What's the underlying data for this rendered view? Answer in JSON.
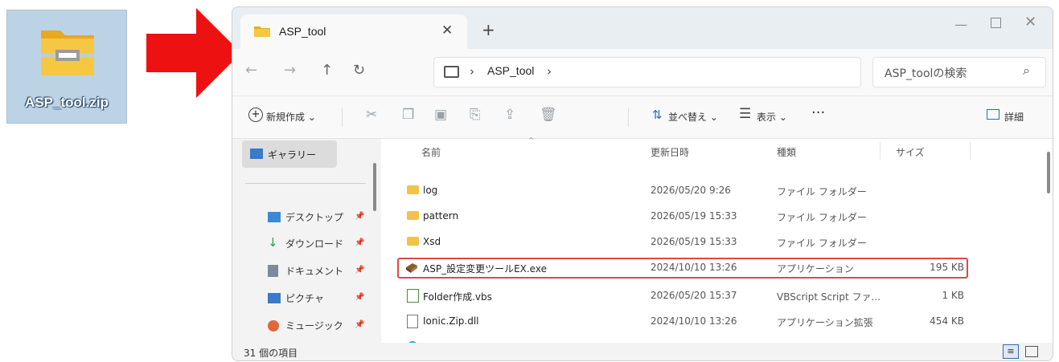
{
  "desktop": {
    "zip_label": "ASP_tool.zip"
  },
  "window": {
    "tab_title": "ASP_tool",
    "breadcrumb": "ASP_tool",
    "search_placeholder": "ASP_toolの検索"
  },
  "toolbar": {
    "new_label": "新規作成 ⌄",
    "sort_label": "並べ替え ⌄",
    "view_label": "表示 ⌄",
    "details_label": "詳細"
  },
  "sidebar": {
    "gallery": "ギャラリー",
    "items": [
      {
        "label": "デスクトップ",
        "icon": "desktop-icon"
      },
      {
        "label": "ダウンロード",
        "icon": "download-icon"
      },
      {
        "label": "ドキュメント",
        "icon": "document-icon"
      },
      {
        "label": "ピクチャ",
        "icon": "pictures-icon"
      },
      {
        "label": "ミュージック",
        "icon": "music-icon"
      }
    ]
  },
  "table": {
    "headers": {
      "name": "名前",
      "date": "更新日時",
      "type": "種類",
      "size": "サイズ"
    },
    "rows": [
      {
        "name": "log",
        "date": "2026/05/20 9:26",
        "type": "ファイル フォルダー",
        "size": "",
        "icon": "folder-icon"
      },
      {
        "name": "pattern",
        "date": "2026/05/19 15:33",
        "type": "ファイル フォルダー",
        "size": "",
        "icon": "folder-icon"
      },
      {
        "name": "Xsd",
        "date": "2026/05/19 15:33",
        "type": "ファイル フォルダー",
        "size": "",
        "icon": "folder-icon"
      },
      {
        "name": "ASP_設定変更ツールEX.exe",
        "date": "2024/10/10 13:26",
        "type": "アプリケーション",
        "size": "195 KB",
        "icon": "exe-icon"
      },
      {
        "name": "Folder作成.vbs",
        "date": "2026/05/20 15:37",
        "type": "VBScript Script ファ...",
        "size": "1 KB",
        "icon": "script-icon"
      },
      {
        "name": "Ionic.Zip.dll",
        "date": "2024/10/10 13:26",
        "type": "アプリケーション拡張",
        "size": "454 KB",
        "icon": "dll-icon"
      }
    ]
  },
  "status": {
    "item_count": "31 個の項目"
  },
  "colors": {
    "arrow": "#ee1111",
    "highlight": "#e04848",
    "folder": "#f3c344",
    "accent": "#2b6cb0"
  }
}
